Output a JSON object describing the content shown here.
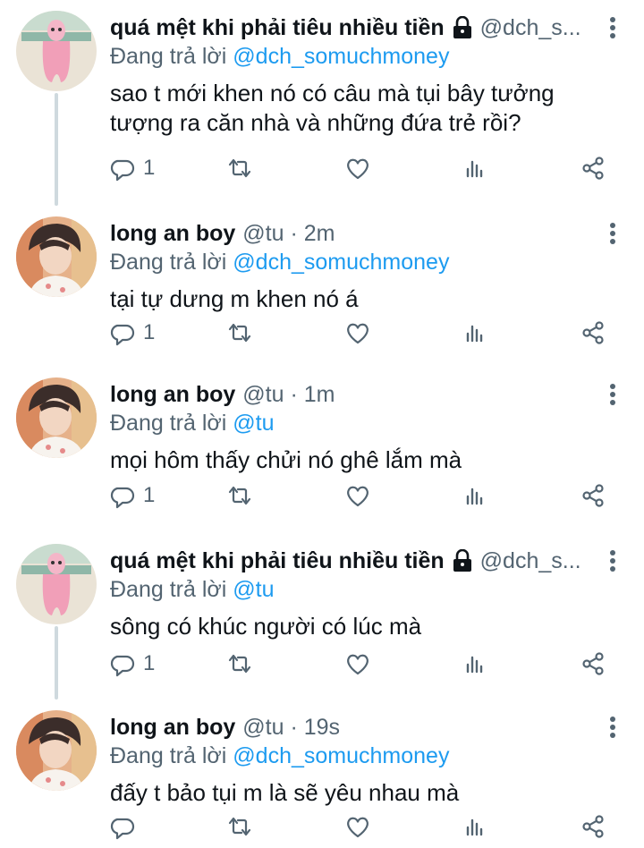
{
  "colors": {
    "name": "#0f1419",
    "secondary": "#536471",
    "mention": "#1d9bf0",
    "thread_line": "#cfd9de"
  },
  "reply_prefix": "Đang trả lời",
  "tweets": [
    {
      "name": "quá mệt khi phải tiêu nhiều tiền",
      "locked": true,
      "handle_meta": "@dch_s...",
      "reply_to": "@dch_somuchmoney",
      "text": "sao t mới khen nó có câu mà tụi bây tưởng tượng ra căn nhà và những đứa trẻ rồi?",
      "reply_count": "1",
      "avatar": "pink-cartoon-avatar"
    },
    {
      "name": "long an boy",
      "locked": false,
      "handle_meta": "@tu · 2m",
      "reply_to": "@dch_somuchmoney",
      "text": "tại tự dưng m khen nó á",
      "reply_count": "1",
      "avatar": "photo-avatar"
    },
    {
      "name": "long an boy",
      "locked": false,
      "handle_meta": "@tu · 1m",
      "reply_to": "@tu",
      "text": "mọi hôm thấy chửi nó ghê lắm mà",
      "reply_count": "1",
      "avatar": "photo-avatar"
    },
    {
      "name": "quá mệt khi phải tiêu nhiều tiền",
      "locked": true,
      "handle_meta": "@dch_s...",
      "reply_to": "@tu",
      "text": "sông có khúc người có lúc mà",
      "reply_count": "1",
      "avatar": "pink-cartoon-avatar"
    },
    {
      "name": "long an boy",
      "locked": false,
      "handle_meta": "@tu · 19s",
      "reply_to": "@dch_somuchmoney",
      "text": "đấy t bảo tụi m là sẽ yêu nhau mà",
      "reply_count": "",
      "avatar": "photo-avatar"
    }
  ]
}
